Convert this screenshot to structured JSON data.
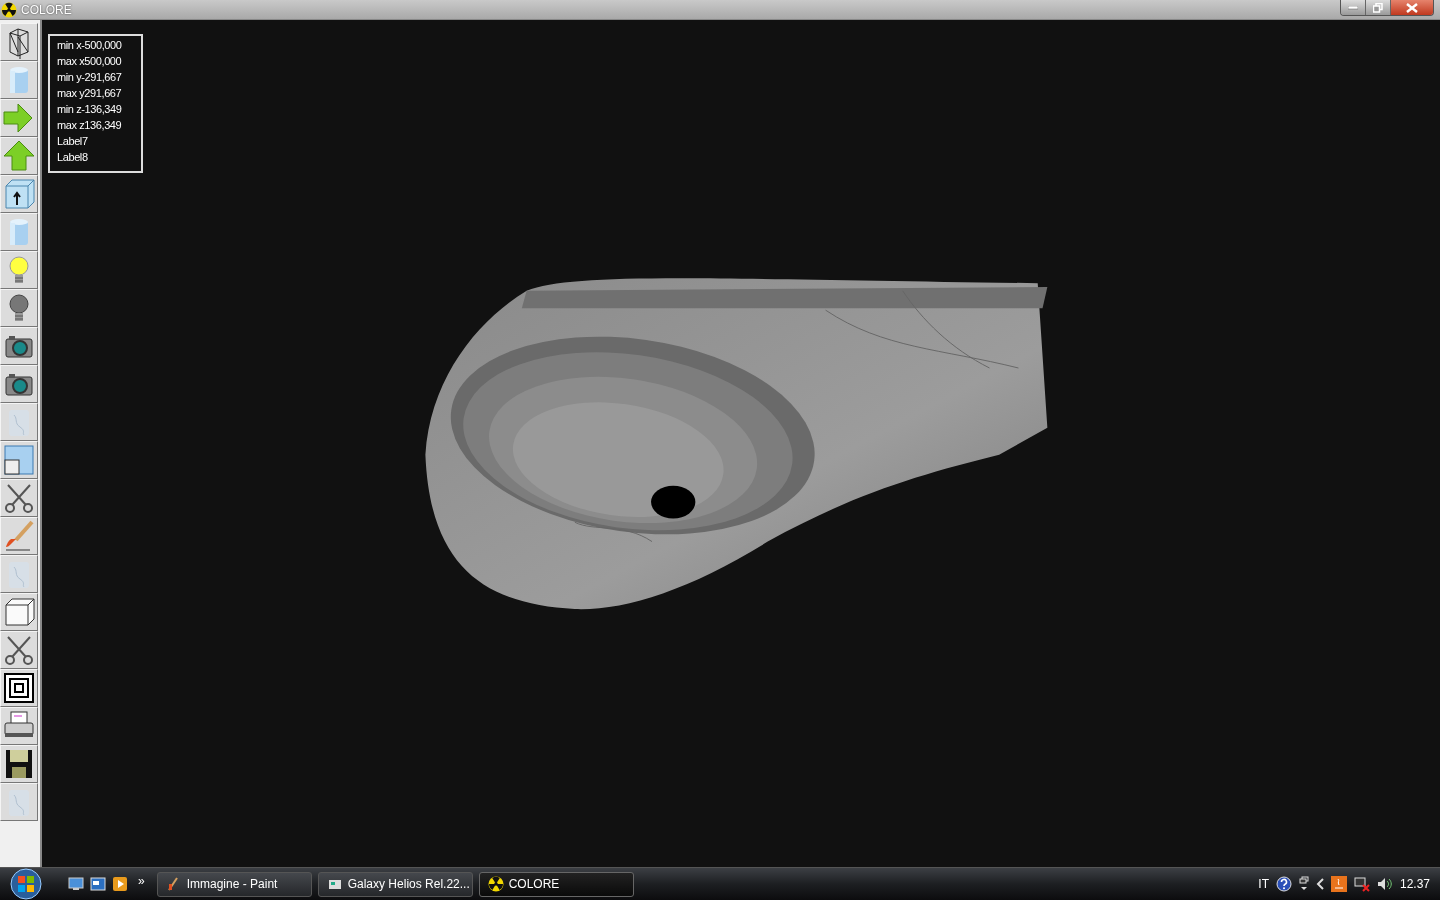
{
  "window": {
    "title": "COLORE"
  },
  "toolbar": [
    {
      "kind": "wireframe"
    },
    {
      "kind": "cylinder"
    },
    {
      "kind": "arrow-right"
    },
    {
      "kind": "arrow-up"
    },
    {
      "kind": "box-arrow"
    },
    {
      "kind": "cylinder"
    },
    {
      "kind": "bulb-lit"
    },
    {
      "kind": "bulb-off"
    },
    {
      "kind": "camera"
    },
    {
      "kind": "camera"
    },
    {
      "kind": "texture"
    },
    {
      "kind": "window"
    },
    {
      "kind": "scissors"
    },
    {
      "kind": "brush"
    },
    {
      "kind": "texture"
    },
    {
      "kind": "cube"
    },
    {
      "kind": "scissors"
    },
    {
      "kind": "squares"
    },
    {
      "kind": "printer"
    },
    {
      "kind": "floppy"
    },
    {
      "kind": "texture"
    }
  ],
  "info_box": [
    "min x-500,000",
    "max x500,000",
    "min y-291,667",
    "max y291,667",
    "min z-136,349",
    "max z136,349",
    "Label7",
    "Label8"
  ],
  "taskbar": {
    "overflow": "»",
    "tasks": [
      {
        "label": "Immagine - Paint",
        "kind": "paint",
        "selected": false
      },
      {
        "label": "Galaxy Helios  Rel.22...",
        "kind": "app",
        "selected": false
      },
      {
        "label": "COLORE",
        "kind": "radiation",
        "selected": true
      }
    ],
    "tray": {
      "language": "IT",
      "clock": "12.37"
    }
  }
}
